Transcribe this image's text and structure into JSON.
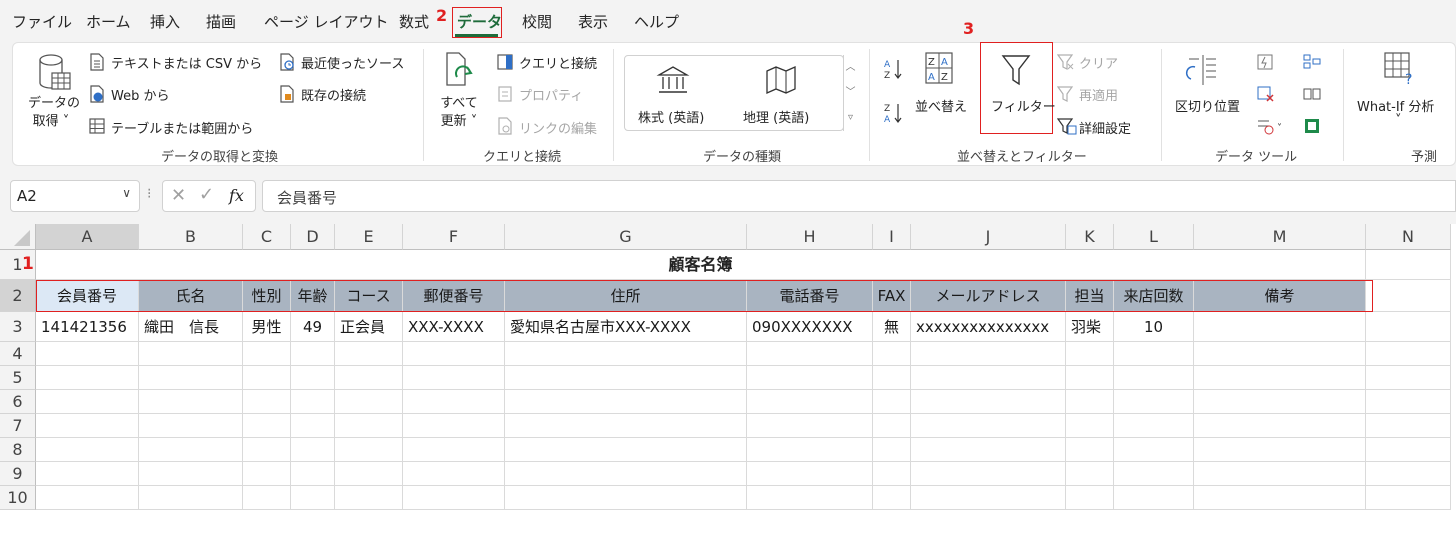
{
  "menu": {
    "items": [
      "ファイル",
      "ホーム",
      "挿入",
      "描画",
      "ページ レイアウト",
      "数式",
      "データ",
      "校閲",
      "表示",
      "ヘルプ"
    ],
    "active": "データ"
  },
  "ribbon": {
    "get_data": {
      "btn_line1": "データの",
      "btn_line2": "取得 ˅",
      "from_text_csv": "テキストまたは CSV から",
      "from_web": "Web から",
      "from_table": "テーブルまたは範囲から",
      "recent_sources": "最近使ったソース",
      "existing_connections": "既存の接続",
      "group_label": "データの取得と変換"
    },
    "queries": {
      "refresh_line1": "すべて",
      "refresh_line2": "更新 ˅",
      "queries_connections": "クエリと接続",
      "properties": "プロパティ",
      "edit_links": "リンクの編集",
      "group_label": "クエリと接続"
    },
    "data_types": {
      "stocks": "株式 (英語)",
      "geography": "地理 (英語)",
      "group_label": "データの種類"
    },
    "sort_filter": {
      "sort": "並べ替え",
      "filter": "フィルター",
      "clear": "クリア",
      "reapply": "再適用",
      "advanced": "詳細設定",
      "group_label": "並べ替えとフィルター"
    },
    "data_tools": {
      "text_to_columns": "区切り位置",
      "group_label": "データ ツール"
    },
    "forecast": {
      "what_if": "What-If 分析",
      "what_if_caret": "˅",
      "group_label": "予測"
    }
  },
  "formula_bar": {
    "name_box": "A2",
    "formula": "会員番号",
    "fx": "fx"
  },
  "steps": {
    "s1": "1",
    "s2": "2",
    "s3": "3"
  },
  "sheet": {
    "columns": [
      "A",
      "B",
      "C",
      "D",
      "E",
      "F",
      "G",
      "H",
      "I",
      "J",
      "K",
      "L",
      "M",
      "N"
    ],
    "rows": [
      "1",
      "2",
      "3",
      "4",
      "5",
      "6",
      "7",
      "8",
      "9",
      "10"
    ],
    "title": "顧客名簿",
    "headers": [
      "会員番号",
      "氏名",
      "性別",
      "年齢",
      "コース",
      "郵便番号",
      "住所",
      "電話番号",
      "FAX",
      "メールアドレス",
      "担当",
      "来店回数",
      "備考"
    ],
    "record": [
      "141421356",
      "織田　信長",
      "男性",
      "49",
      "正会員",
      "XXX-XXXX",
      "愛知県名古屋市XXX-XXXX",
      "090XXXXXXX",
      "無",
      "xxxxxxxxxxxxxxx",
      "羽柴",
      "10",
      ""
    ]
  },
  "colors": {
    "accent": "#1e6b3a",
    "header_fill": "#a9b4c1",
    "highlight": "#e02020"
  }
}
